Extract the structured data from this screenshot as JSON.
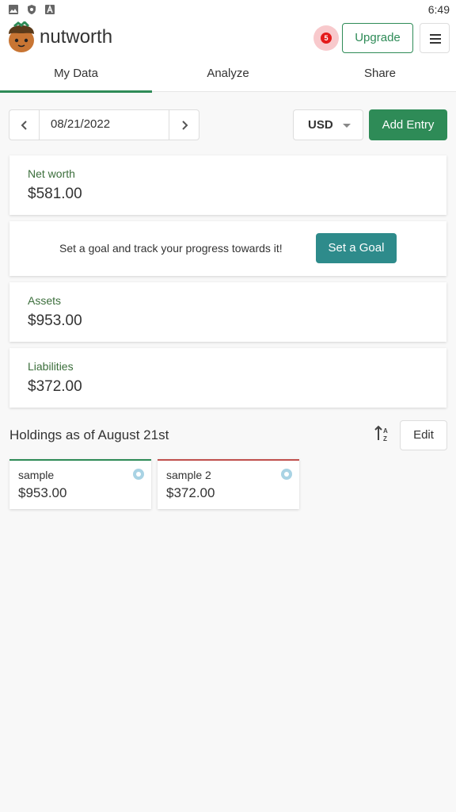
{
  "status_bar": {
    "time": "6:49",
    "icons": [
      "image-icon",
      "shield-icon",
      "a-icon"
    ]
  },
  "app": {
    "name": "nutworth",
    "notification_count": "5",
    "upgrade_label": "Upgrade",
    "menu_icon": "hamburger-icon",
    "brand_color": "#2e8b57",
    "accent_teal": "#2e8b8b"
  },
  "tabs": [
    {
      "label": "My Data",
      "active": true
    },
    {
      "label": "Analyze",
      "active": false
    },
    {
      "label": "Share",
      "active": false
    }
  ],
  "toolbar": {
    "date": "08/21/2022",
    "prev_icon": "chevron-left-icon",
    "next_icon": "chevron-right-icon",
    "currency": "USD",
    "add_entry_label": "Add Entry"
  },
  "summary": {
    "net_worth_label": "Net worth",
    "net_worth_value": "$581.00",
    "goal_text": "Set a goal and track your progress towards it!",
    "goal_button": "Set a Goal",
    "assets_label": "Assets",
    "assets_value": "$953.00",
    "liabilities_label": "Liabilities",
    "liabilities_value": "$372.00"
  },
  "holdings": {
    "title": "Holdings as of August 21st",
    "sort_icon": "sort-alpha-icon",
    "edit_label": "Edit",
    "items": [
      {
        "name": "sample",
        "value": "$953.00",
        "type_color": "#2e8b57"
      },
      {
        "name": "sample 2",
        "value": "$372.00",
        "type_color": "#c0504d"
      }
    ]
  }
}
